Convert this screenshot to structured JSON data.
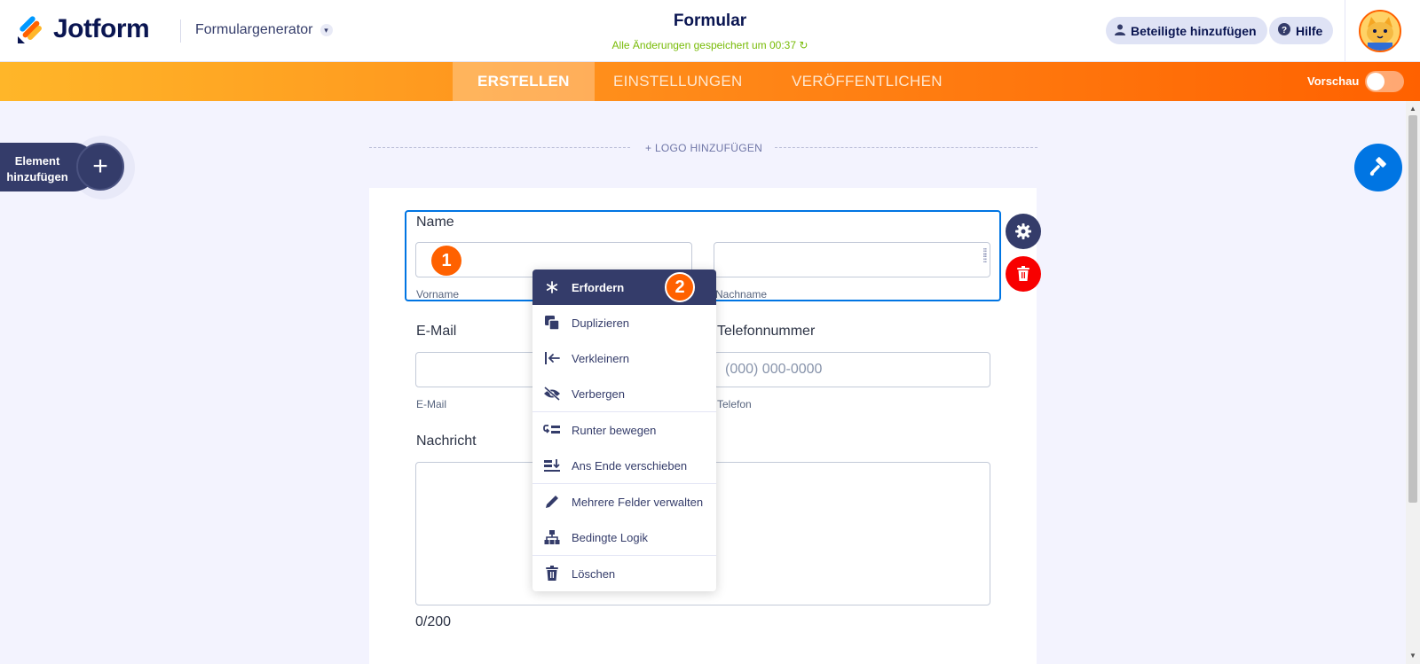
{
  "header": {
    "brand": "Jotform",
    "product": "Formulargenerator",
    "form_title": "Formular",
    "save_status": "Alle Änderungen gespeichert um 00:37",
    "add_participants": "Beteiligte hinzufügen",
    "help": "Hilfe"
  },
  "nav": {
    "tabs": [
      {
        "label": "ERSTELLEN",
        "active": true
      },
      {
        "label": "EINSTELLUNGEN",
        "active": false
      },
      {
        "label": "VERÖFFENTLICHEN",
        "active": false
      }
    ],
    "preview_label": "Vorschau"
  },
  "sidebar": {
    "add_element_line1": "Element",
    "add_element_line2": "hinzufügen"
  },
  "form": {
    "add_logo": "+ LOGO HINZUFÜGEN",
    "name_label": "Name",
    "first_name_sublabel": "Vorname",
    "last_name_sublabel": "Nachname",
    "email_label": "E-Mail",
    "email_sublabel": "E-Mail",
    "phone_label": "Telefonnummer",
    "phone_placeholder": "(000) 000-0000",
    "phone_sublabel": "Telefon",
    "message_label": "Nachricht",
    "message_counter": "0/200"
  },
  "badges": [
    "1",
    "2"
  ],
  "context_menu": {
    "items": [
      {
        "label": "Erfordern",
        "icon": "asterisk-icon"
      },
      {
        "label": "Duplizieren",
        "icon": "duplicate-icon"
      },
      {
        "label": "Verkleinern",
        "icon": "shrink-icon"
      },
      {
        "label": "Verbergen",
        "icon": "eye-off-icon"
      },
      {
        "label": "Runter bewegen",
        "icon": "move-down-icon"
      },
      {
        "label": "Ans Ende verschieben",
        "icon": "move-to-end-icon"
      },
      {
        "label": "Mehrere Felder verwalten",
        "icon": "pencil-icon"
      },
      {
        "label": "Bedingte Logik",
        "icon": "logic-icon"
      },
      {
        "label": "Löschen",
        "icon": "trash-icon"
      }
    ]
  },
  "colors": {
    "navy": "#343c6a",
    "orange": "#ff6100",
    "blue": "#0075e3",
    "red": "#f80000",
    "green": "#78bb07"
  }
}
